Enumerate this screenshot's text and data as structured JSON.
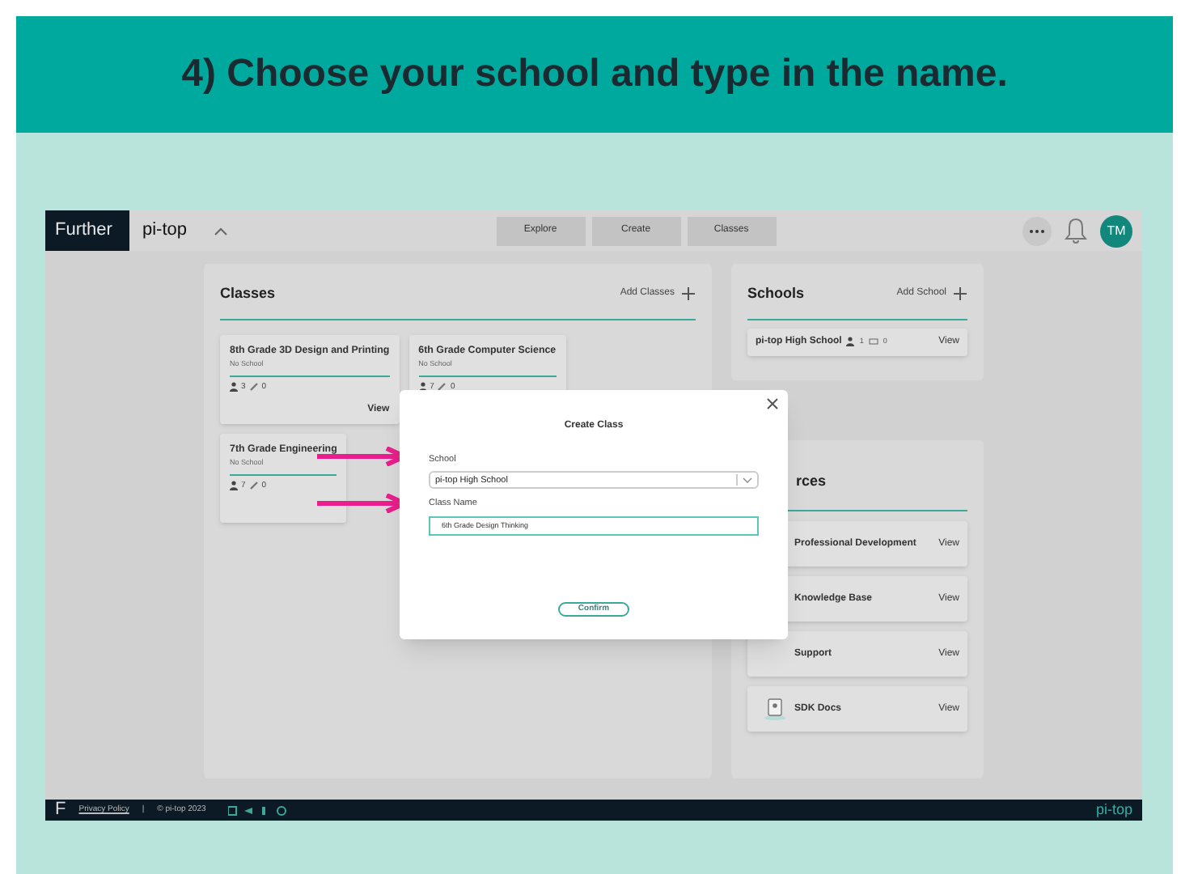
{
  "slide_title": "4) Choose your school and type in the name.",
  "app": {
    "nav": {
      "brand": "Further",
      "org": "pi-top",
      "tabs": [
        {
          "label": "Explore",
          "selected": false
        },
        {
          "label": "Create",
          "selected": false
        },
        {
          "label": "Classes",
          "selected": false
        }
      ],
      "avatar": "TM"
    },
    "classes_panel": {
      "title": "Classes",
      "action": "Add Classes",
      "cards": [
        {
          "name": "8th Grade 3D Design and Printing",
          "school": "No School",
          "students": "3",
          "assignments": "0",
          "view": "View"
        },
        {
          "name": "6th Grade Computer Science",
          "school": "No School",
          "students": "7",
          "assignments": "0"
        },
        {
          "name": "7th Grade Engineering",
          "school": "No School",
          "students": "7",
          "assignments": "0"
        }
      ]
    },
    "schools_panel": {
      "title": "Schools",
      "action": "Add School",
      "items": [
        {
          "name": "pi-top High School",
          "students": "1",
          "classes": "0",
          "view": "View"
        }
      ]
    },
    "resources_panel": {
      "title": "rces",
      "items": [
        {
          "name": "Professional Development",
          "view": "View"
        },
        {
          "name": "Knowledge Base",
          "view": "View"
        },
        {
          "name": "Support",
          "view": "View"
        },
        {
          "name": "SDK Docs",
          "view": "View",
          "icon": true
        }
      ]
    },
    "dialog": {
      "title": "Create Class",
      "fields": [
        {
          "kind": "select",
          "label": "School",
          "value": "pi-top High School"
        },
        {
          "kind": "text",
          "label": "Class Name",
          "value": "6th Grade Design Thinking"
        }
      ],
      "confirm": "Confirm"
    },
    "footer": {
      "logo": "F",
      "privacy": "Privacy Policy",
      "separator": "|",
      "copyright": "© pi-top 2023",
      "brand": "pi-top"
    }
  }
}
